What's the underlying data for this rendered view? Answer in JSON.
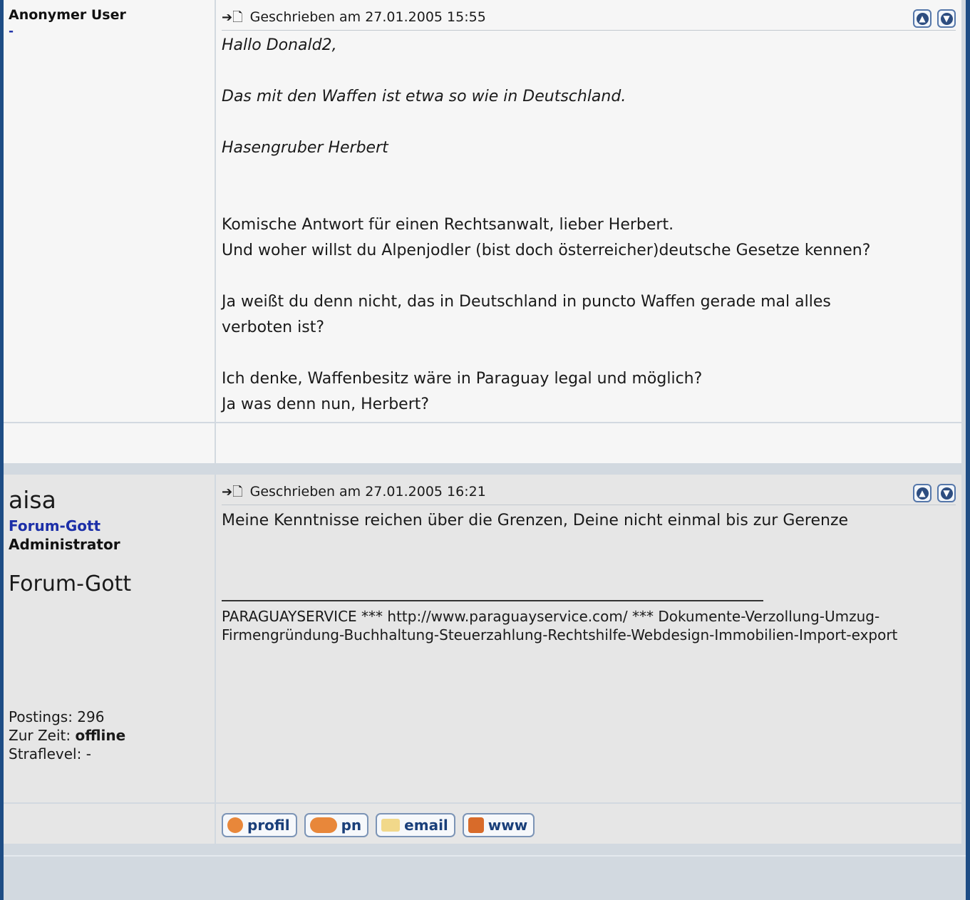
{
  "post1": {
    "author": "Anonymer User",
    "author_sub": "-",
    "arrow_icon": "➔🗋",
    "date": "Geschrieben am 27.01.2005 15:55",
    "quote_lines": [
      "Hallo Donald2,",
      "",
      "Das mit den Waffen ist etwa so wie in Deutschland.",
      "",
      "Hasengruber Herbert"
    ],
    "body_lines": [
      "Komische Antwort für einen Rechtsanwalt, lieber Herbert.",
      "Und woher willst du Alpenjodler (bist doch österreicher)deutsche Gesetze kennen?",
      "",
      "Ja weißt du denn nicht, das in Deutschland in puncto Waffen gerade mal alles",
      "verboten ist?",
      "",
      "Ich denke, Waffenbesitz wäre in Paraguay legal und möglich?",
      "Ja was denn nun, Herbert?"
    ]
  },
  "post2": {
    "author": "aisa",
    "rank1": "Forum-Gott",
    "rank2": "Administrator",
    "rank3": "Forum-Gott",
    "stats": {
      "postings_label": "Postings: ",
      "postings": "296",
      "status_label": "Zur Zeit: ",
      "status": "offline",
      "straflevel_label": "Straflevel: ",
      "straflevel": "-"
    },
    "date": "Geschrieben am 27.01.2005 16:21",
    "body": "Meine Kenntnisse reichen über die Grenzen, Deine nicht einmal bis zur Gerenze",
    "signature": "PARAGUAYSERVICE *** http://www.paraguayservice.com/ *** Dokumente-Verzollung-Umzug-Firmengründung-Buchhaltung-Steuerzahlung-Rechtshilfe-Webdesign-Immobilien-Import-export",
    "buttons": {
      "profil": "profil",
      "pn": "pn",
      "email": "email",
      "www": "www"
    }
  },
  "icons": {
    "up": "up-arrow-icon",
    "down": "down-arrow-icon"
  }
}
